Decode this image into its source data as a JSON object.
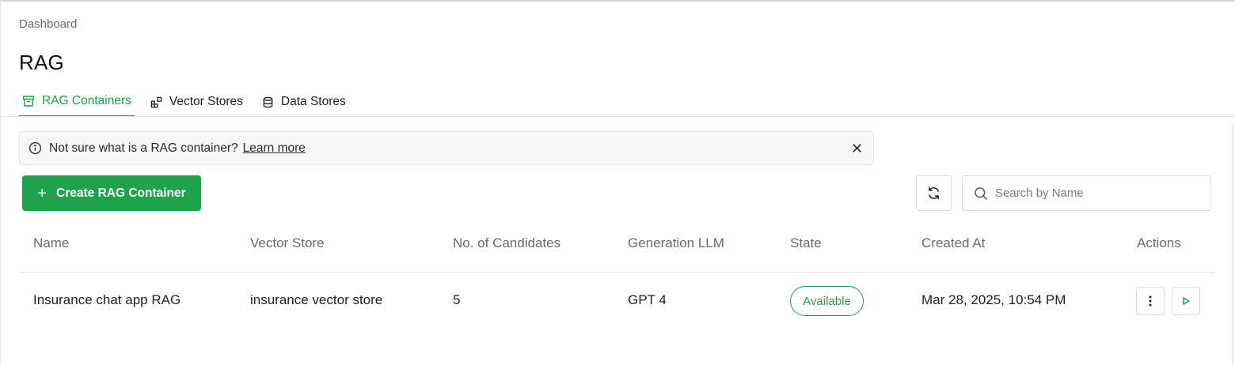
{
  "breadcrumb": "Dashboard",
  "page_title": "RAG",
  "tabs": [
    {
      "label": "RAG Containers",
      "icon": "archive-icon",
      "active": true
    },
    {
      "label": "Vector Stores",
      "icon": "blocks-icon",
      "active": false
    },
    {
      "label": "Data Stores",
      "icon": "database-icon",
      "active": false
    }
  ],
  "info_banner": {
    "message": "Not sure what is a RAG container?",
    "link": "Learn more",
    "icon": "info-icon",
    "close_icon": "close-icon"
  },
  "toolbar": {
    "create_label": "Create RAG Container",
    "create_icon": "plus-icon",
    "refresh_icon": "refresh-icon",
    "search_placeholder": "Search by Name",
    "search_value": "",
    "search_icon": "search-icon"
  },
  "table": {
    "headers": [
      "Name",
      "Vector Store",
      "No. of Candidates",
      "Generation LLM",
      "State",
      "Created At",
      "Actions"
    ],
    "rows": [
      {
        "name": "Insurance chat app RAG",
        "vector_store": "insurance vector store",
        "candidates": "5",
        "llm": "GPT 4",
        "state": "Available",
        "created_at": "Mar 28, 2025, 10:54 PM",
        "actions": [
          "more-vertical-icon",
          "play-icon"
        ]
      }
    ]
  },
  "colors": {
    "accent": "#1ea34c",
    "status_available": "#2e9a4f",
    "muted_text": "#6a6a6a"
  }
}
